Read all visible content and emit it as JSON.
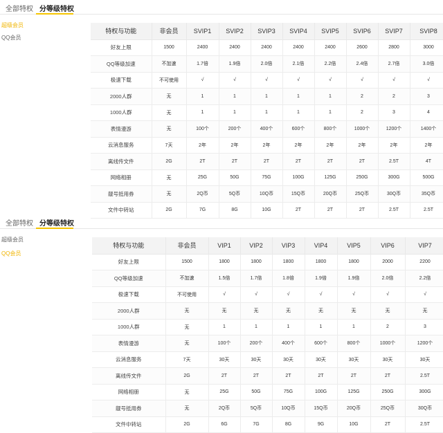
{
  "accent_color": "#f5c400",
  "tabs": [
    "全部特权",
    "分等级特权"
  ],
  "panels": [
    {
      "sidebar": [
        {
          "label": "超级会员",
          "active": true
        },
        {
          "label": "QQ会员",
          "active": false
        }
      ],
      "headers": [
        "特权与功能",
        "非会员",
        "SVIP1",
        "SVIP2",
        "SVIP3",
        "SVIP4",
        "SVIP5",
        "SVIP6",
        "SVIP7",
        "SVIP8"
      ],
      "rows": [
        [
          "好友上限",
          "1500",
          "2400",
          "2400",
          "2400",
          "2400",
          "2400",
          "2600",
          "2800",
          "3000"
        ],
        [
          "QQ等级加速",
          "不加速",
          "1.7倍",
          "1.9倍",
          "2.0倍",
          "2.1倍",
          "2.2倍",
          "2.4倍",
          "2.7倍",
          "3.0倍"
        ],
        [
          "极速下载",
          "不可使用",
          "√",
          "√",
          "√",
          "√",
          "√",
          "√",
          "√",
          "√"
        ],
        [
          "2000人群",
          "无",
          "1",
          "1",
          "1",
          "1",
          "1",
          "2",
          "2",
          "3"
        ],
        [
          "1000人群",
          "无",
          "1",
          "1",
          "1",
          "1",
          "1",
          "2",
          "3",
          "4"
        ],
        [
          "表情漫游",
          "无",
          "100个",
          "200个",
          "400个",
          "600个",
          "800个",
          "1000个",
          "1200个",
          "1400个"
        ],
        [
          "云消息服务",
          "7天",
          "2年",
          "2年",
          "2年",
          "2年",
          "2年",
          "2年",
          "2年",
          "2年"
        ],
        [
          "离线传文件",
          "2G",
          "2T",
          "2T",
          "2T",
          "2T",
          "2T",
          "2T",
          "2.5T",
          "4T"
        ],
        [
          "网络相册",
          "无",
          "25G",
          "50G",
          "75G",
          "100G",
          "125G",
          "250G",
          "300G",
          "500G"
        ],
        [
          "靓号抵用券",
          "无",
          "2Q币",
          "5Q币",
          "10Q币",
          "15Q币",
          "20Q币",
          "25Q币",
          "30Q币",
          "35Q币"
        ],
        [
          "文件中转站",
          "2G",
          "7G",
          "8G",
          "10G",
          "2T",
          "2T",
          "2T",
          "2.5T",
          "2.5T"
        ]
      ]
    },
    {
      "sidebar": [
        {
          "label": "超级会员",
          "active": false
        },
        {
          "label": "QQ会员",
          "active": true
        }
      ],
      "headers": [
        "特权与功能",
        "非会员",
        "VIP1",
        "VIP2",
        "VIP3",
        "VIP4",
        "VIP5",
        "VIP6",
        "VIP7"
      ],
      "rows": [
        [
          "好友上限",
          "1500",
          "1800",
          "1800",
          "1800",
          "1800",
          "1800",
          "2000",
          "2200"
        ],
        [
          "QQ等级加速",
          "不加速",
          "1.5倍",
          "1.7倍",
          "1.8倍",
          "1.9倍",
          "1.9倍",
          "2.0倍",
          "2.2倍"
        ],
        [
          "极速下载",
          "不可使用",
          "√",
          "√",
          "√",
          "√",
          "√",
          "√",
          "√"
        ],
        [
          "2000人群",
          "无",
          "无",
          "无",
          "无",
          "无",
          "无",
          "无",
          "无"
        ],
        [
          "1000人群",
          "无",
          "1",
          "1",
          "1",
          "1",
          "1",
          "2",
          "3"
        ],
        [
          "表情漫游",
          "无",
          "100个",
          "200个",
          "400个",
          "600个",
          "800个",
          "1000个",
          "1200个"
        ],
        [
          "云消息服务",
          "7天",
          "30天",
          "30天",
          "30天",
          "30天",
          "30天",
          "30天",
          "30天"
        ],
        [
          "离线传文件",
          "2G",
          "2T",
          "2T",
          "2T",
          "2T",
          "2T",
          "2T",
          "2.5T"
        ],
        [
          "网络相册",
          "无",
          "25G",
          "50G",
          "75G",
          "100G",
          "125G",
          "250G",
          "300G"
        ],
        [
          "靓号抵用券",
          "无",
          "2Q币",
          "5Q币",
          "10Q币",
          "15Q币",
          "20Q币",
          "25Q币",
          "30Q币"
        ],
        [
          "文件中转站",
          "2G",
          "6G",
          "7G",
          "8G",
          "9G",
          "10G",
          "2T",
          "2.5T"
        ]
      ]
    }
  ]
}
